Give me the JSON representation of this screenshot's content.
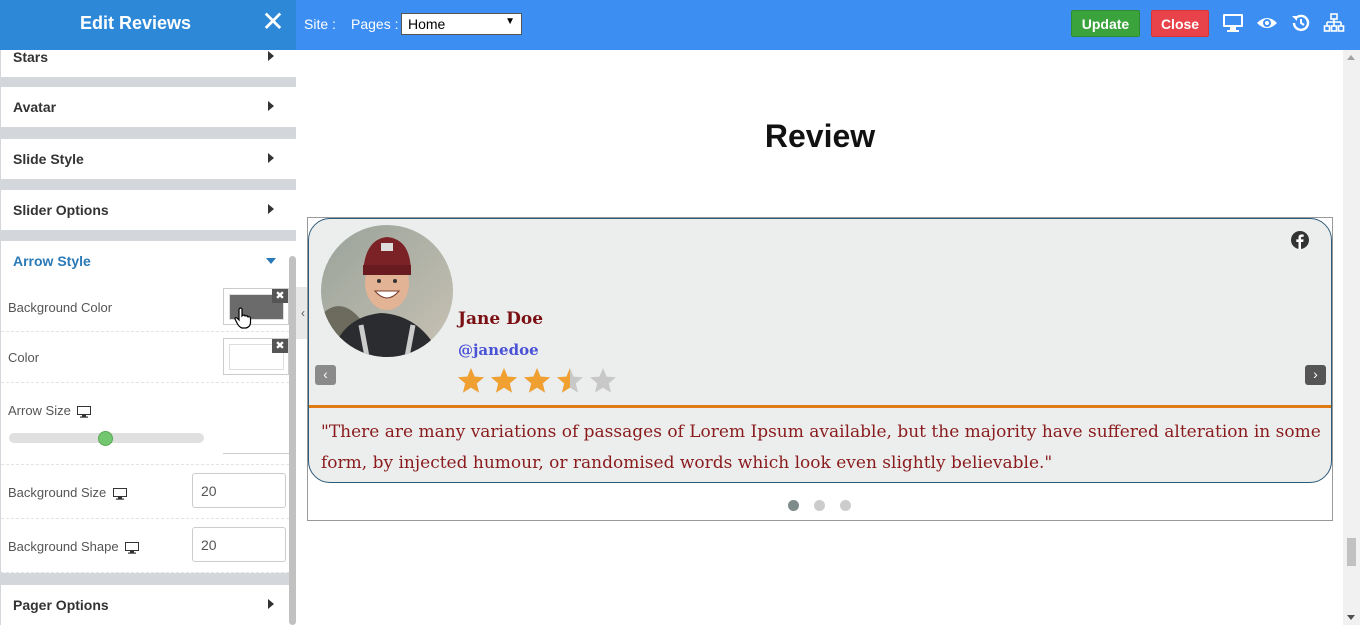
{
  "panel": {
    "title": "Edit Reviews",
    "close_glyph": "✕"
  },
  "topbar": {
    "site_label": "Site :",
    "pages_label": "Pages :",
    "pages_value": "Home",
    "update_label": "Update",
    "close_label": "Close",
    "icons": [
      "desktop-icon",
      "eye-icon",
      "history-icon",
      "sitemap-icon"
    ]
  },
  "sidebar": {
    "sections": [
      {
        "label": "Stars"
      },
      {
        "label": "Avatar"
      },
      {
        "label": "Slide Style"
      },
      {
        "label": "Slider Options"
      },
      {
        "label": "Arrow Style"
      },
      {
        "label": "Pager Options"
      }
    ],
    "arrow_style": {
      "background_color_label": "Background Color",
      "background_color_value": "#6b6b6b",
      "color_label": "Color",
      "color_value": "#ffffff",
      "arrow_size_label": "Arrow Size",
      "arrow_size_level": 0.5,
      "background_size_label": "Background Size",
      "background_size_value": "20",
      "background_shape_label": "Background Shape",
      "background_shape_value": "20",
      "remove_glyph": "✖"
    },
    "collapse_glyph": "‹"
  },
  "main": {
    "heading": "Review",
    "review": {
      "name": "Jane Doe",
      "handle": "@janedoe",
      "rating": 3.5,
      "rating_max": 5,
      "quote": "\"There are many variations of passages of Lorem Ipsum available, but the majority have suffered alteration in some form, by injected humour, or randomised words which look even slightly believable.\"",
      "social_icon": "facebook-icon"
    },
    "prev_glyph": "‹",
    "next_glyph": "›",
    "pager": {
      "count": 3,
      "active": 0
    }
  },
  "colors": {
    "topbar": "#3d8ef3",
    "update": "#3aa33c",
    "close": "#e8424a",
    "star_filled": "#f0a030",
    "star_empty": "#c8c8c8",
    "divider": "#e07a14"
  }
}
